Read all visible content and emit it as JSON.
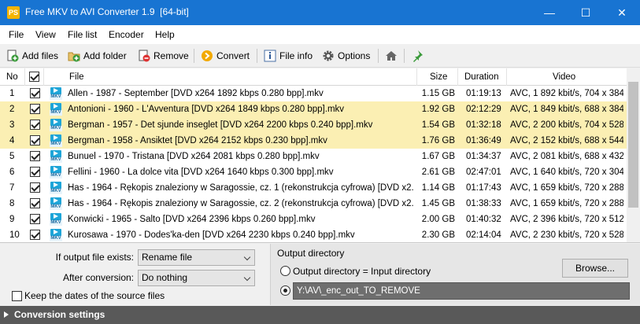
{
  "window": {
    "title": "Free MKV to AVI Converter 1.9  [64-bit]",
    "app_icon_text": "PS",
    "minimize": "—",
    "maximize": "☐",
    "close": "✕"
  },
  "menu": [
    "File",
    "View",
    "File list",
    "Encoder",
    "Help"
  ],
  "toolbar": {
    "add_files": "Add files",
    "add_folder": "Add folder",
    "remove": "Remove",
    "convert": "Convert",
    "file_info": "File info",
    "options": "Options"
  },
  "columns": {
    "no": "No",
    "file": "File",
    "size": "Size",
    "duration": "Duration",
    "video": "Video"
  },
  "rows": [
    {
      "no": "1",
      "file": "Allen - 1987 - September [DVD x264 1892 kbps 0.280 bpp].mkv",
      "size": "1.15 GB",
      "duration": "01:19:13",
      "video": "AVC, 1 892 kbit/s, 704 x 384",
      "highlight": false
    },
    {
      "no": "2",
      "file": "Antonioni - 1960 - L'Avventura [DVD x264 1849 kbps 0.280 bpp].mkv",
      "size": "1.92 GB",
      "duration": "02:12:29",
      "video": "AVC, 1 849 kbit/s, 688 x 384",
      "highlight": true
    },
    {
      "no": "3",
      "file": "Bergman - 1957 - Det sjunde inseglet [DVD x264 2200 kbps 0.240 bpp].mkv",
      "size": "1.54 GB",
      "duration": "01:32:18",
      "video": "AVC, 2 200 kbit/s, 704 x 528",
      "highlight": true
    },
    {
      "no": "4",
      "file": "Bergman - 1958 - Ansiktet [DVD x264 2152 kbps 0.230 bpp].mkv",
      "size": "1.76 GB",
      "duration": "01:36:49",
      "video": "AVC, 2 152 kbit/s, 688 x 544",
      "highlight": true
    },
    {
      "no": "5",
      "file": "Bunuel - 1970 - Tristana [DVD x264 2081 kbps 0.280 bpp].mkv",
      "size": "1.67 GB",
      "duration": "01:34:37",
      "video": "AVC, 2 081 kbit/s, 688 x 432",
      "highlight": false
    },
    {
      "no": "6",
      "file": "Fellini - 1960 - La dolce vita [DVD x264 1640 kbps 0.300 bpp].mkv",
      "size": "2.61 GB",
      "duration": "02:47:01",
      "video": "AVC, 1 640 kbit/s, 720 x 304",
      "highlight": false
    },
    {
      "no": "7",
      "file": "Has - 1964 - Rękopis znaleziony w Saragossie, cz. 1 (rekonstrukcja cyfrowa) [DVD x2...",
      "size": "1.14 GB",
      "duration": "01:17:43",
      "video": "AVC, 1 659 kbit/s, 720 x 288",
      "highlight": false
    },
    {
      "no": "8",
      "file": "Has - 1964 - Rękopis znaleziony w Saragossie, cz. 2 (rekonstrukcja cyfrowa) [DVD x2...",
      "size": "1.45 GB",
      "duration": "01:38:33",
      "video": "AVC, 1 659 kbit/s, 720 x 288",
      "highlight": false
    },
    {
      "no": "9",
      "file": "Konwicki - 1965 - Salto [DVD x264 2396 kbps 0.260 bpp].mkv",
      "size": "2.00 GB",
      "duration": "01:40:32",
      "video": "AVC, 2 396 kbit/s, 720 x 512",
      "highlight": false
    },
    {
      "no": "10",
      "file": "Kurosawa - 1970 - Dodes'ka-den [DVD x264 2230 kbps 0.240 bpp].mkv",
      "size": "2.30 GB",
      "duration": "02:14:04",
      "video": "AVC, 2 230 kbit/s, 720 x 528",
      "highlight": false
    }
  ],
  "file_icon_label": "MKV",
  "settings": {
    "if_exists_label": "If output file exists:",
    "if_exists_value": "Rename file",
    "after_label": "After conversion:",
    "after_value": "Do nothing",
    "keep_dates_label": "Keep the dates of the source files"
  },
  "output": {
    "heading": "Output directory",
    "option_same": "Output directory = Input directory",
    "browse": "Browse...",
    "path": "Y:\\AV\\_enc_out_TO_REMOVE"
  },
  "conversion_settings": "Conversion settings",
  "colors": {
    "titlebar": "#1874d2",
    "highlight_row": "#fbefb3",
    "conv_bar": "#595959"
  }
}
